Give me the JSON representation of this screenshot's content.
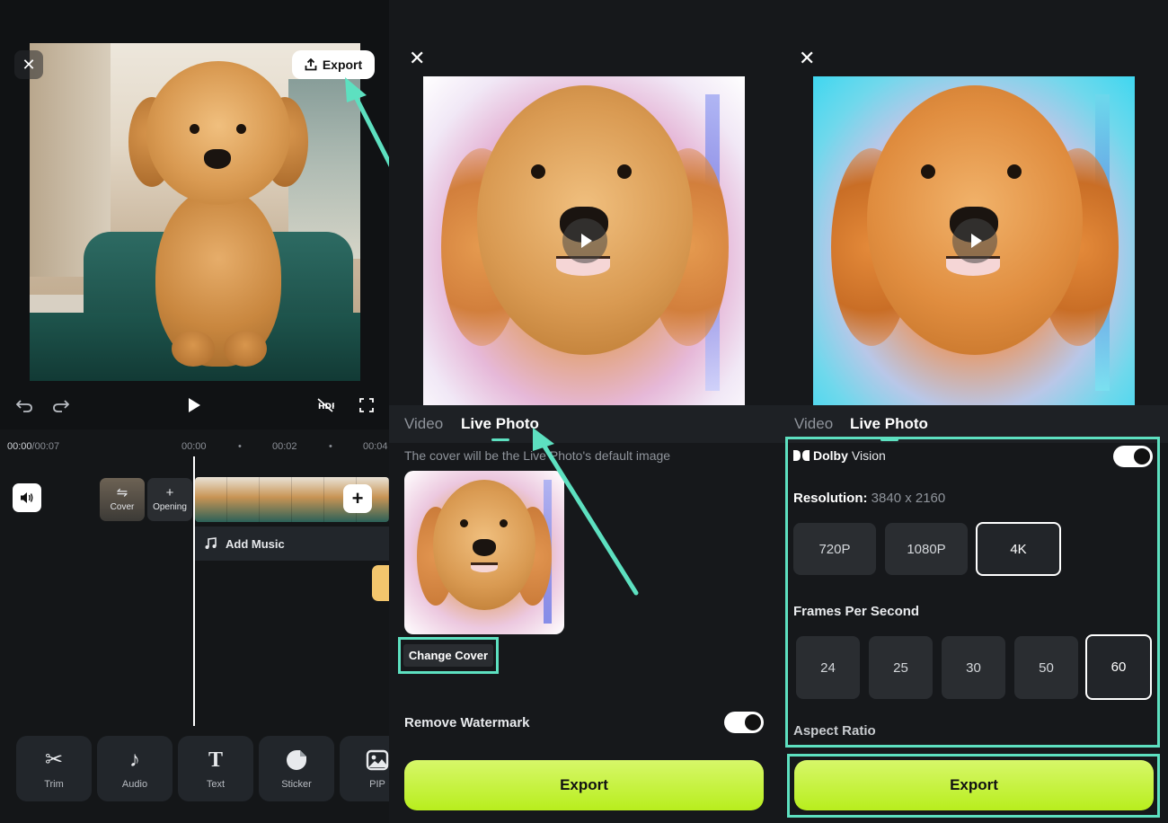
{
  "editor": {
    "close_label": "✕",
    "export_label": "Export",
    "time": {
      "current": "00:00",
      "total": "/00:07"
    },
    "ruler": [
      "00:00",
      "•",
      "00:02",
      "•",
      "00:04"
    ],
    "cover_label": "Cover",
    "opening_label": "Opening",
    "add_music_label": "Add Music",
    "tools": [
      "Trim",
      "Audio",
      "Text",
      "Sticker",
      "PIP"
    ]
  },
  "live_photo_panel": {
    "close_label": "✕",
    "tabs": {
      "video": "Video",
      "live_photo": "Live Photo"
    },
    "cover_note": "The cover will be the Live Photo's default image",
    "change_cover_label": "Change Cover",
    "remove_watermark_label": "Remove Watermark",
    "remove_watermark_on": true,
    "export_label": "Export"
  },
  "settings_panel": {
    "close_label": "✕",
    "tabs": {
      "video": "Video",
      "live_photo": "Live Photo"
    },
    "dolby": {
      "name": "Dolby",
      "vision": "Vision",
      "enabled": true
    },
    "resolution": {
      "label": "Resolution:",
      "value": "3840 x 2160",
      "options": [
        "720P",
        "1080P",
        "4K"
      ],
      "selected": "4K"
    },
    "fps": {
      "label": "Frames Per Second",
      "options": [
        "24",
        "25",
        "30",
        "50",
        "60"
      ],
      "selected": "60"
    },
    "aspect_ratio_label": "Aspect Ratio",
    "export_label": "Export"
  },
  "colors": {
    "accent_highlight": "#5de0c0",
    "export_button": "#c6f23c",
    "background": "#16181b"
  },
  "icons": {
    "upload": "upload-icon",
    "undo": "undo-icon",
    "redo": "redo-icon",
    "play": "play-icon",
    "hdr": "hdr-icon",
    "fullscreen": "fullscreen-icon",
    "volume": "volume-icon",
    "music": "music-note-icon",
    "trim": "scissors-icon",
    "audio": "music-note-icon",
    "text": "text-t-icon",
    "sticker": "sticker-icon",
    "pip": "pip-icon"
  }
}
